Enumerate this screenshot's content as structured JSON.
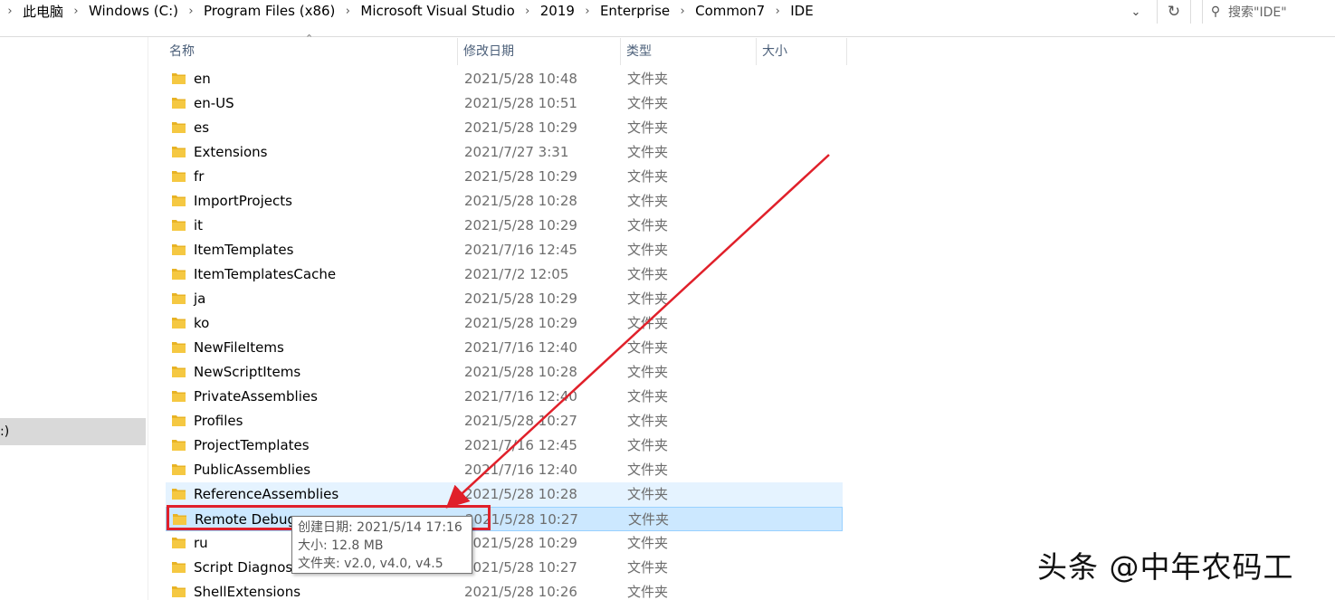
{
  "address_bar": {
    "breadcrumbs": [
      "此电脑",
      "Windows (C:)",
      "Program Files (x86)",
      "Microsoft Visual Studio",
      "2019",
      "Enterprise",
      "Common7",
      "IDE"
    ],
    "search_placeholder": "搜索\"IDE\"",
    "dropdown_icon": "chevron-down-icon",
    "refresh_icon": "refresh-icon"
  },
  "nav": {
    "selected_item_partial": ":)"
  },
  "columns": {
    "name": "名称",
    "date": "修改日期",
    "type": "类型",
    "size": "大小"
  },
  "files": [
    {
      "name": "en",
      "date": "2021/5/28 10:48",
      "type": "文件夹"
    },
    {
      "name": "en-US",
      "date": "2021/5/28 10:51",
      "type": "文件夹"
    },
    {
      "name": "es",
      "date": "2021/5/28 10:29",
      "type": "文件夹"
    },
    {
      "name": "Extensions",
      "date": "2021/7/27 3:31",
      "type": "文件夹"
    },
    {
      "name": "fr",
      "date": "2021/5/28 10:29",
      "type": "文件夹"
    },
    {
      "name": "ImportProjects",
      "date": "2021/5/28 10:28",
      "type": "文件夹"
    },
    {
      "name": "it",
      "date": "2021/5/28 10:29",
      "type": "文件夹"
    },
    {
      "name": "ItemTemplates",
      "date": "2021/7/16 12:45",
      "type": "文件夹"
    },
    {
      "name": "ItemTemplatesCache",
      "date": "2021/7/2 12:05",
      "type": "文件夹"
    },
    {
      "name": "ja",
      "date": "2021/5/28 10:29",
      "type": "文件夹"
    },
    {
      "name": "ko",
      "date": "2021/5/28 10:29",
      "type": "文件夹"
    },
    {
      "name": "NewFileItems",
      "date": "2021/7/16 12:40",
      "type": "文件夹"
    },
    {
      "name": "NewScriptItems",
      "date": "2021/5/28 10:28",
      "type": "文件夹"
    },
    {
      "name": "PrivateAssemblies",
      "date": "2021/7/16 12:40",
      "type": "文件夹"
    },
    {
      "name": "Profiles",
      "date": "2021/5/28 10:27",
      "type": "文件夹"
    },
    {
      "name": "ProjectTemplates",
      "date": "2021/7/16 12:45",
      "type": "文件夹"
    },
    {
      "name": "PublicAssemblies",
      "date": "2021/7/16 12:40",
      "type": "文件夹"
    },
    {
      "name": "ReferenceAssemblies",
      "date": "2021/5/28 10:28",
      "type": "文件夹",
      "state": "hover"
    },
    {
      "name": "Remote Debug",
      "date": "2021/5/28 10:27",
      "type": "文件夹",
      "state": "selected"
    },
    {
      "name": "ru",
      "date": "2021/5/28 10:29",
      "type": "文件夹"
    },
    {
      "name": "Script Diagnost",
      "date": "2021/5/28 10:27",
      "type": "文件夹"
    },
    {
      "name": "ShellExtensions",
      "date": "2021/5/28 10:26",
      "type": "文件夹"
    }
  ],
  "tooltip": {
    "created": "创建日期: 2021/5/14 17:16",
    "size": "大小: 12.8 MB",
    "folders": "文件夹: v2.0, v4.0, v4.5"
  },
  "watermark": "头条 @中年农码工",
  "colors": {
    "folder": "#f5c842",
    "annotation_red": "#e0202a",
    "selected_bg": "#cce8ff",
    "hover_bg": "#e5f3ff"
  }
}
